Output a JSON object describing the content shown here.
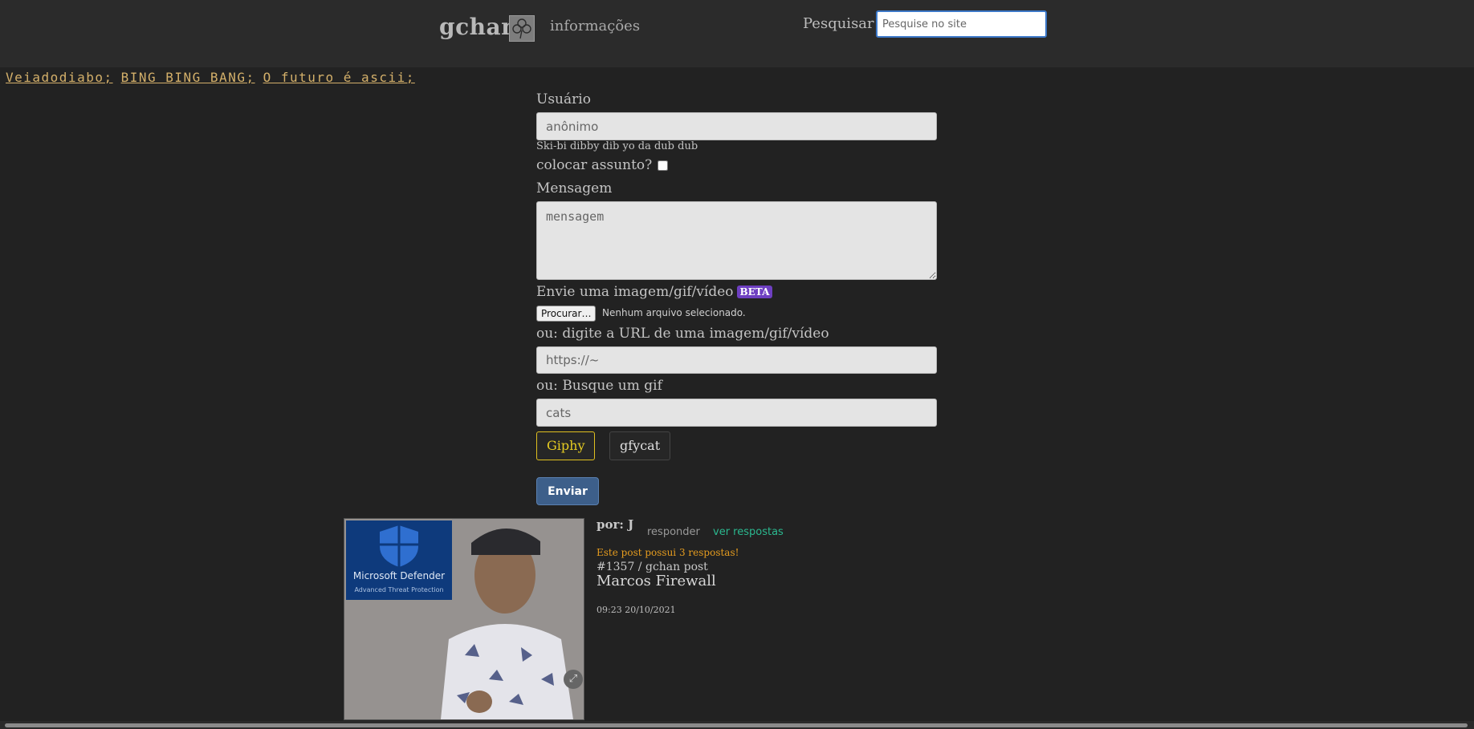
{
  "header": {
    "brand": "gchan",
    "info_link": "informações",
    "search_label": "Pesquisar",
    "search_placeholder": "Pesquise no site"
  },
  "boards": [
    "Veiadodiabo;",
    "BING BING BANG;",
    "O futuro é ascii;"
  ],
  "form": {
    "user_label": "Usuário",
    "user_placeholder": "anônimo",
    "hint": "Ski-bi dibby dib yo da dub dub",
    "subject_label": "colocar assunto?",
    "message_label": "Mensagem",
    "message_placeholder": "mensagem",
    "upload_label": "Envie uma imagem/gif/vídeo",
    "beta_badge": "BETA",
    "file_button": "Procurar…",
    "file_status": "Nenhum arquivo selecionado.",
    "url_label": "ou: digite a URL de uma imagem/gif/vídeo",
    "url_placeholder": "https://~",
    "gif_search_label": "ou: Busque um gif",
    "gif_search_placeholder": "cats",
    "giphy_button": "Giphy",
    "gfycat_button": "gfycat",
    "submit_button": "Enviar"
  },
  "post": {
    "author": "por: J",
    "reply": "responder",
    "see_replies": "ver respostas",
    "notice": "Este post possui 3 respostas!",
    "id_line": "#1357 / gchan post",
    "title": "Marcos Firewall",
    "timestamp": "09:23 20/10/2021",
    "image_overlay_title": "Microsoft Defender",
    "image_overlay_subtitle": "Advanced Threat Protection"
  },
  "colors": {
    "background": "#222222",
    "topbar": "#2b2b2b",
    "board_link": "#d4b06a",
    "beta": "#6e3fc1",
    "giphy": "#e6cc22",
    "see_replies": "#2bb88f",
    "notice": "#e59c1f",
    "submit": "#3d5f8a"
  }
}
